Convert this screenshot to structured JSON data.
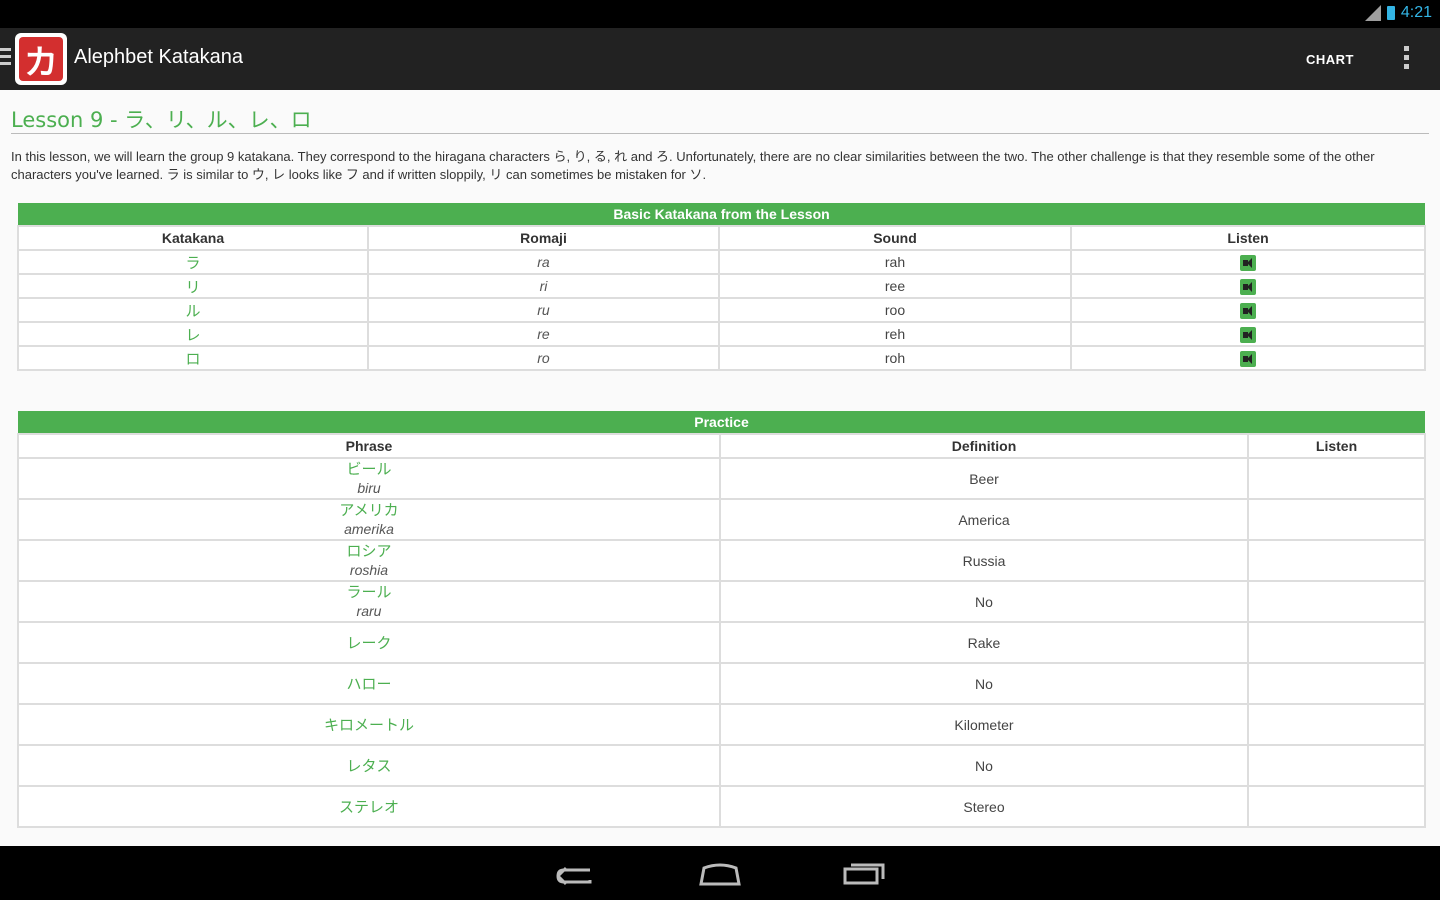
{
  "status_bar": {
    "time": "4:21"
  },
  "action_bar": {
    "app_icon_char": "カ",
    "title": "Alephbet Katakana",
    "chart_label": "CHART"
  },
  "lesson": {
    "title": "Lesson 9 - ラ、リ、ル、レ、ロ",
    "intro": "In this lesson, we will learn the group 9 katakana. They correspond to the hiragana characters ら, り, る, れ and ろ. Unfortunately, there are no clear similarities between the two. The other challenge is that they resemble some of the other characters you've learned. ラ is similar to ウ, レ looks like フ and if written sloppily, リ can sometimes be mistaken for ソ."
  },
  "basic_table": {
    "caption": "Basic Katakana from the Lesson",
    "headers": [
      "Katakana",
      "Romaji",
      "Sound",
      "Listen"
    ],
    "rows": [
      {
        "kana": "ラ",
        "romaji": "ra",
        "sound": "rah"
      },
      {
        "kana": "リ",
        "romaji": "ri",
        "sound": "ree"
      },
      {
        "kana": "ル",
        "romaji": "ru",
        "sound": "roo"
      },
      {
        "kana": "レ",
        "romaji": "re",
        "sound": "reh"
      },
      {
        "kana": "ロ",
        "romaji": "ro",
        "sound": "roh"
      }
    ]
  },
  "practice_table": {
    "caption": "Practice",
    "headers": [
      "Phrase",
      "Definition",
      "Listen"
    ],
    "rows": [
      {
        "kana": "ビール",
        "romaji": "biru",
        "definition": "Beer"
      },
      {
        "kana": "アメリカ",
        "romaji": "amerika",
        "definition": "America"
      },
      {
        "kana": "ロシア",
        "romaji": "roshia",
        "definition": "Russia"
      },
      {
        "kana": "ラール",
        "romaji": "raru",
        "definition": "No"
      },
      {
        "kana": "レーク",
        "romaji": "",
        "definition": "Rake"
      },
      {
        "kana": "ハロー",
        "romaji": "",
        "definition": "No"
      },
      {
        "kana": "キロメートル",
        "romaji": "",
        "definition": "Kilometer"
      },
      {
        "kana": "レタス",
        "romaji": "",
        "definition": "No"
      },
      {
        "kana": "ステレオ",
        "romaji": "",
        "definition": "Stereo"
      }
    ]
  },
  "icons": {
    "status": [
      "signal-icon",
      "battery-icon"
    ],
    "listen": "speaker-icon",
    "nav": [
      "back-icon",
      "home-icon",
      "recents-icon"
    ]
  },
  "colors": {
    "accent": "#4caf50",
    "action_bar": "#222222",
    "status_text": "#33b5e5",
    "app_icon": "#d32f2f"
  }
}
